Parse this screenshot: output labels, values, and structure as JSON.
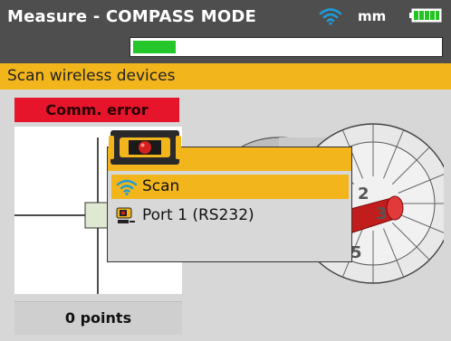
{
  "title_bar": {
    "title": "Measure - COMPASS MODE",
    "units": "mm",
    "wifi_icon": "wifi-icon",
    "battery_icon": "battery-icon",
    "progress_fraction": 0.08
  },
  "scan_bar": {
    "label": "Scan wireless devices"
  },
  "status": {
    "error": "Comm. error"
  },
  "points": {
    "label": "0 points"
  },
  "dial": {
    "labels": [
      "2",
      "3",
      "5"
    ]
  },
  "popup": {
    "items": [
      {
        "label": "Scan",
        "icon": "wifi-icon",
        "selected": true
      },
      {
        "label": "Port 1 (RS232)",
        "icon": "port-device-icon",
        "selected": false
      }
    ]
  },
  "colors": {
    "accent_yellow": "#f2b51c",
    "error_red": "#e6152b",
    "wifi_blue": "#1e9bd7",
    "progress_green": "#24c62a",
    "titlebar_grey": "#4e4e4e"
  }
}
